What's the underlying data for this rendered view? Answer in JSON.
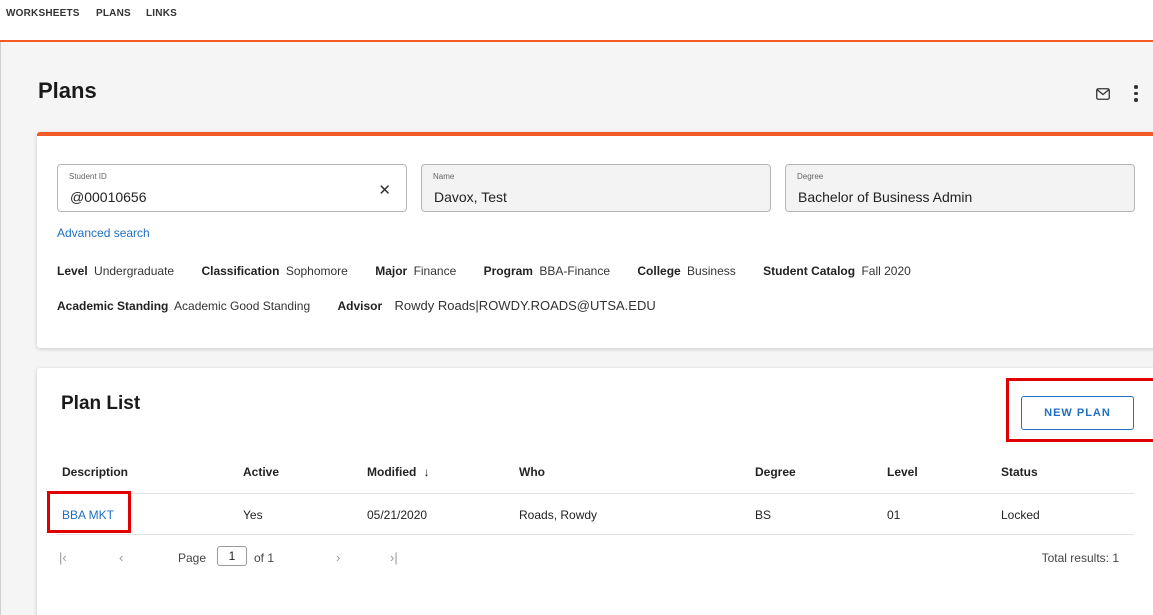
{
  "nav": {
    "tabs": [
      "WORKSHEETS",
      "PLANS",
      "LINKS"
    ]
  },
  "page": {
    "title": "Plans"
  },
  "icons": {
    "mail": "mail-icon",
    "more": "more-vert-icon",
    "clear": "close-icon",
    "sort_desc": "arrow-down-icon"
  },
  "colors": {
    "accent_orange": "#f15a22",
    "link_blue": "#1f6fc2",
    "highlight_red": "#e00000"
  },
  "student": {
    "id_label": "Student ID",
    "id_value": "@00010656",
    "name_label": "Name",
    "name_value": "Davox, Test",
    "degree_label": "Degree",
    "degree_value": "Bachelor of Business Admin",
    "advanced_search": "Advanced search",
    "info_row1": [
      {
        "label": "Level",
        "value": "Undergraduate"
      },
      {
        "label": "Classification",
        "value": "Sophomore"
      },
      {
        "label": "Major",
        "value": "Finance"
      },
      {
        "label": "Program",
        "value": "BBA-Finance"
      },
      {
        "label": "College",
        "value": "Business"
      },
      {
        "label": "Student Catalog",
        "value": "Fall 2020"
      }
    ],
    "info_row2": [
      {
        "label": "Academic Standing",
        "value": "Academic Good Standing"
      },
      {
        "label": "Advisor",
        "value": "Rowdy Roads|ROWDY.ROADS@UTSA.EDU"
      }
    ]
  },
  "plan_list": {
    "title": "Plan List",
    "new_plan_label": "NEW PLAN",
    "columns": [
      "Description",
      "Active",
      "Modified",
      "Who",
      "Degree",
      "Level",
      "Status"
    ],
    "rows": [
      {
        "description": "BBA MKT",
        "active": "Yes",
        "modified": "05/21/2020",
        "who": "Roads, Rowdy",
        "degree": "BS",
        "level": "01",
        "status": "Locked"
      }
    ],
    "pager": {
      "page_label": "Page",
      "page_value": "1",
      "of_label": "of 1",
      "total": "Total results: 1"
    }
  }
}
